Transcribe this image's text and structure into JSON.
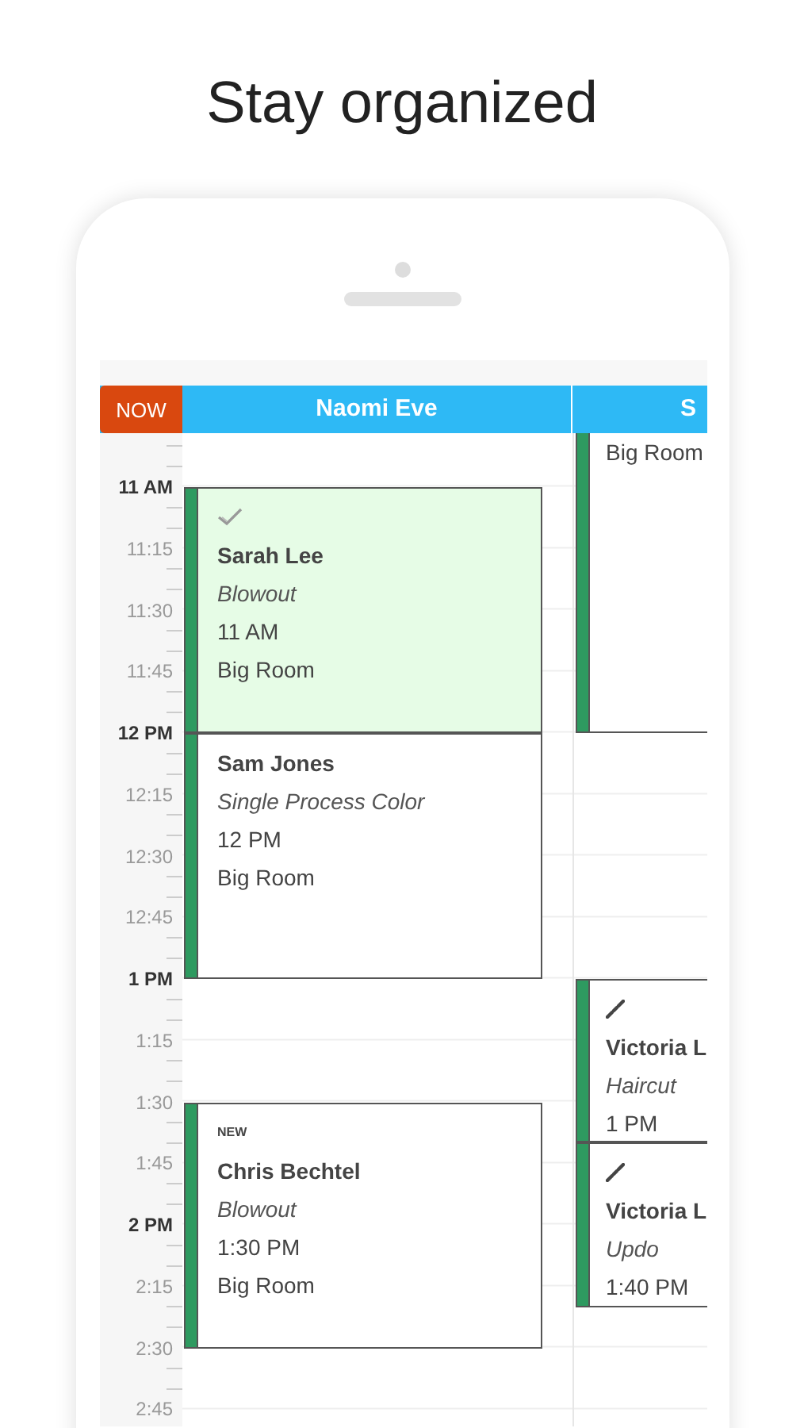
{
  "headline": "Stay organized",
  "now_button": "NOW",
  "time_labels": [
    {
      "text": "11 AM",
      "kind": "hour"
    },
    {
      "text": "11:15",
      "kind": "quarter"
    },
    {
      "text": "11:30",
      "kind": "quarter"
    },
    {
      "text": "11:45",
      "kind": "quarter"
    },
    {
      "text": "12 PM",
      "kind": "hour"
    },
    {
      "text": "12:15",
      "kind": "quarter"
    },
    {
      "text": "12:30",
      "kind": "quarter"
    },
    {
      "text": "12:45",
      "kind": "quarter"
    },
    {
      "text": "1 PM",
      "kind": "hour"
    },
    {
      "text": "1:15",
      "kind": "quarter"
    },
    {
      "text": "1:30",
      "kind": "quarter"
    },
    {
      "text": "1:45",
      "kind": "quarter"
    },
    {
      "text": "2 PM",
      "kind": "hour"
    },
    {
      "text": "2:15",
      "kind": "quarter"
    },
    {
      "text": "2:30",
      "kind": "quarter"
    },
    {
      "text": "2:45",
      "kind": "quarter"
    }
  ],
  "columns": [
    {
      "name": "Naomi Eve",
      "appointments": [
        {
          "checked_in": true,
          "linked": false,
          "client": "Sarah Lee",
          "service": "Blowout",
          "time": "11 AM",
          "room": "Big Room"
        },
        {
          "checked_in": false,
          "linked": false,
          "client": "Sam Jones",
          "service": "Single Process Color",
          "time": "12 PM",
          "room": "Big Room"
        },
        {
          "checked_in": false,
          "linked": false,
          "badge": "NEW",
          "client": "Chris Bechtel",
          "service": "Blowout",
          "time": "1:30 PM",
          "room": "Big Room"
        }
      ]
    },
    {
      "name": "S",
      "appointments": [
        {
          "checked_in": false,
          "linked": false,
          "room": "Big Room"
        },
        {
          "checked_in": false,
          "linked": true,
          "client": "Victoria L",
          "service": "Haircut",
          "time": "1 PM"
        },
        {
          "checked_in": false,
          "linked": true,
          "client": "Victoria L",
          "service": "Updo",
          "time": "1:40 PM"
        }
      ]
    }
  ]
}
